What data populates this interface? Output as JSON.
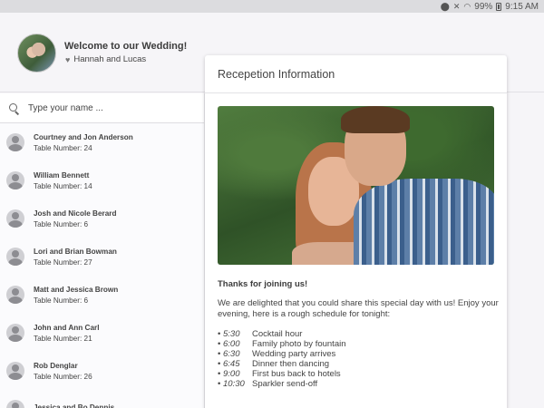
{
  "status_bar": {
    "battery": "99%",
    "time": "9:15 AM"
  },
  "header": {
    "welcome": "Welcome to our Wedding!",
    "couple": "Hannah and Lucas"
  },
  "search": {
    "placeholder": "Type your name ..."
  },
  "guests": [
    {
      "name": "Courtney and Jon Anderson",
      "table": "Table Number: 24"
    },
    {
      "name": "William Bennett",
      "table": "Table Number: 14"
    },
    {
      "name": "Josh and Nicole Berard",
      "table": "Table Number: 6"
    },
    {
      "name": "Lori and Brian Bowman",
      "table": "Table Number: 27"
    },
    {
      "name": "Matt and Jessica Brown",
      "table": "Table Number: 6"
    },
    {
      "name": "John and Ann Carl",
      "table": "Table Number: 21"
    },
    {
      "name": "Rob Denglar",
      "table": "Table Number: 26"
    },
    {
      "name": "Jessica and Bo Dennis",
      "table": ""
    }
  ],
  "card": {
    "title": "Recepetion Information",
    "thanks": "Thanks for joining us!",
    "intro": "We are delighted that you could share this special day with us! Enjoy your evening, here is a rough schedule for tonight:",
    "schedule": [
      {
        "time": "5:30",
        "event": "Cocktail hour"
      },
      {
        "time": "6:00",
        "event": "Family photo by fountain"
      },
      {
        "time": "6:30",
        "event": "Wedding party arrives"
      },
      {
        "time": "6:45",
        "event": "Dinner then dancing"
      },
      {
        "time": "9:00",
        "event": "First bus back to hotels"
      },
      {
        "time": "10:30",
        "event": "Sparkler send-off"
      }
    ]
  }
}
